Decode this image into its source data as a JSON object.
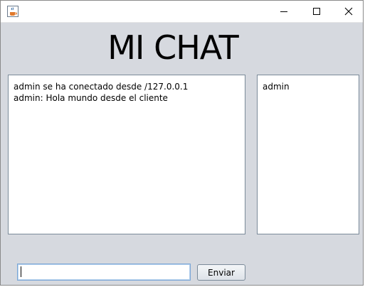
{
  "window": {
    "title": "",
    "icon": "java-coffee-icon",
    "controls": [
      "minimize-icon",
      "maximize-icon",
      "close-icon"
    ]
  },
  "header": {
    "title": "MI CHAT"
  },
  "chat": {
    "messages": [
      "admin se ha conectado desde /127.0.0.1",
      "admin: Hola mundo desde el cliente"
    ]
  },
  "users": {
    "items": [
      "admin"
    ]
  },
  "composer": {
    "input_value": "",
    "send_label": "Enviar"
  },
  "colors": {
    "window_bg": "#d6d9df",
    "panel_border": "#7a8a99",
    "input_focus_border": "#7aa6d6"
  }
}
